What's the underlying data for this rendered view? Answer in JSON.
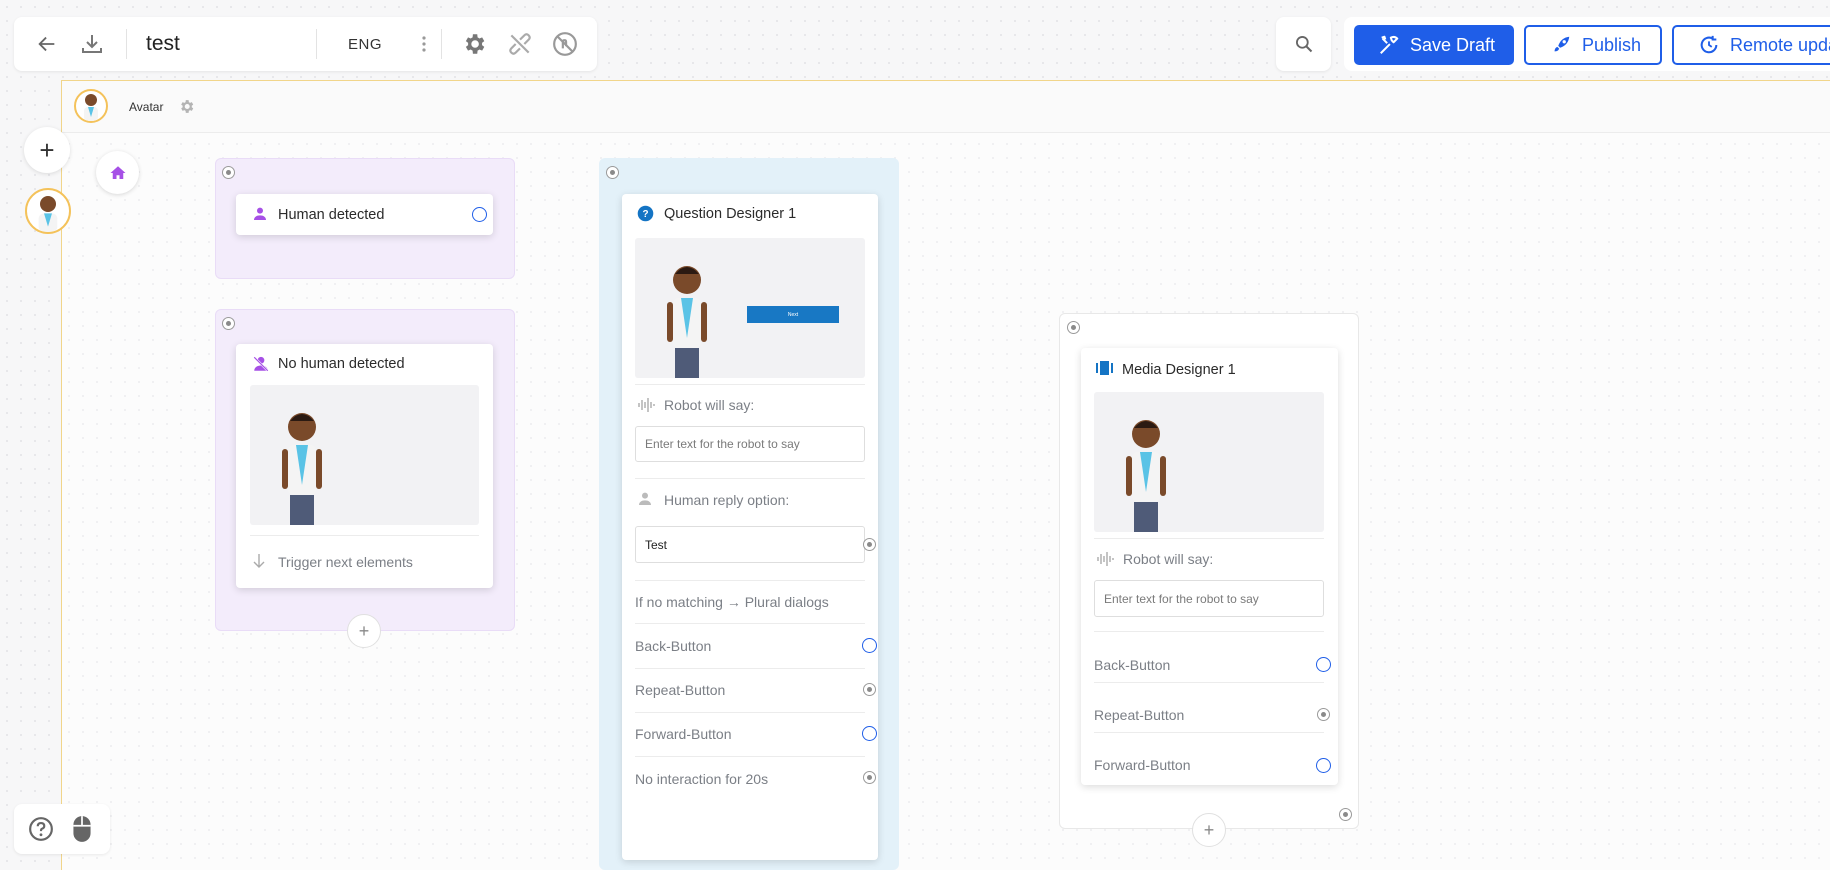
{
  "toolbar": {
    "back_icon": "arrow-left-icon",
    "download_icon": "download-icon",
    "title": "test",
    "language": "ENG",
    "more_icon": "vertical-dots-icon",
    "settings_icon": "gear-icon",
    "unlink_icon": "link-off-icon",
    "disable_icon": "no-touch-icon"
  },
  "actions": {
    "search_icon": "search-icon",
    "save_draft": "Save Draft",
    "publish": "Publish",
    "remote_update": "Remote upda"
  },
  "avatar_bar": {
    "name": "Avatar"
  },
  "left_rail": {
    "add_label": "+"
  },
  "nodes": {
    "human_detected": {
      "title": "Human detected"
    },
    "no_human": {
      "title": "No human detected",
      "trigger": "Trigger next elements"
    },
    "question": {
      "title": "Question Designer 1",
      "robot_label": "Robot will say:",
      "robot_placeholder": "Enter text for the robot to say",
      "human_label": "Human reply option:",
      "reply_value": "Test",
      "no_match": "If no matching → Plural dialogs",
      "back": "Back-Button",
      "repeat": "Repeat-Button",
      "forward": "Forward-Button",
      "no_interaction": "No interaction for 20s",
      "preview_button_text": "Next"
    },
    "media": {
      "title": "Media Designer 1",
      "robot_label": "Robot will say:",
      "robot_placeholder": "Enter text for the robot to say",
      "back": "Back-Button",
      "repeat": "Repeat-Button",
      "forward": "Forward-Button"
    }
  },
  "bottom_left": {
    "help_icon": "help-circle-icon",
    "mouse_icon": "mouse-icon"
  },
  "colors": {
    "primary": "#1f5ee8",
    "purple_group": "#f3ecfb",
    "blue_group": "#e3f1f9",
    "avatar_border": "#f4c25a"
  }
}
